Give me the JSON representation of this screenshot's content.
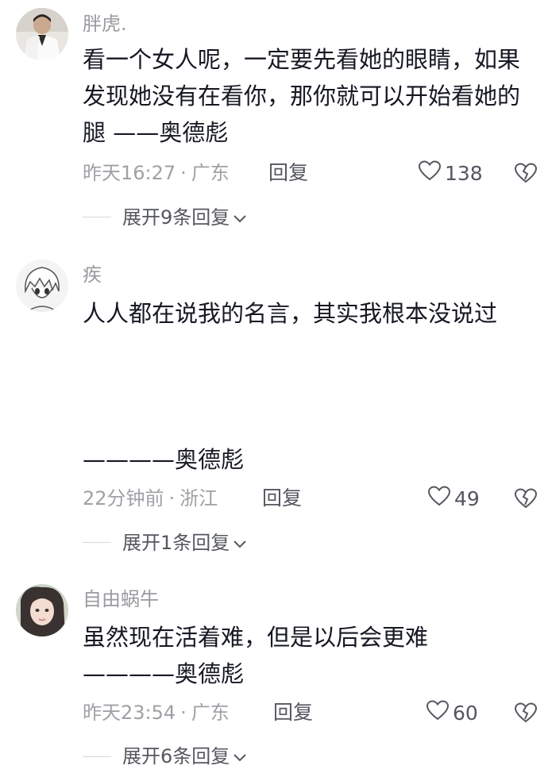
{
  "comments": [
    {
      "username": "胖虎.",
      "text": "看一个女人呢，一定要先看她的眼睛，如果发现她没有在看你，那你就可以开始看她的腿 ——奥德彪",
      "time": "昨天16:27",
      "separator": "·",
      "location": "广东",
      "reply_label": "回复",
      "likes": "138",
      "expand_label": "展开9条回复",
      "avatar": "man-in-white-shirt"
    },
    {
      "username": "疾",
      "text": "人人都在说我的名言，其实我根本没说过\n\n\n\n————奥德彪",
      "time": "22分钟前",
      "separator": "·",
      "location": "浙江",
      "reply_label": "回复",
      "likes": "49",
      "expand_label": "展开1条回复",
      "avatar": "anime-boy-sketch"
    },
    {
      "username": "自由蜗牛",
      "text": "虽然现在活着难，但是以后会更难\n————奥德彪",
      "time": "昨天23:54",
      "separator": "·",
      "location": "广东",
      "reply_label": "回复",
      "likes": "60",
      "expand_label": "展开6条回复",
      "avatar": "girl-portrait"
    }
  ],
  "icons": {
    "like": "heart-outline-icon",
    "dislike": "broken-heart-icon",
    "expand": "chevron-down-icon"
  },
  "colors": {
    "text": "#161823",
    "secondary": "#a0a1a6",
    "action": "#55575f"
  }
}
